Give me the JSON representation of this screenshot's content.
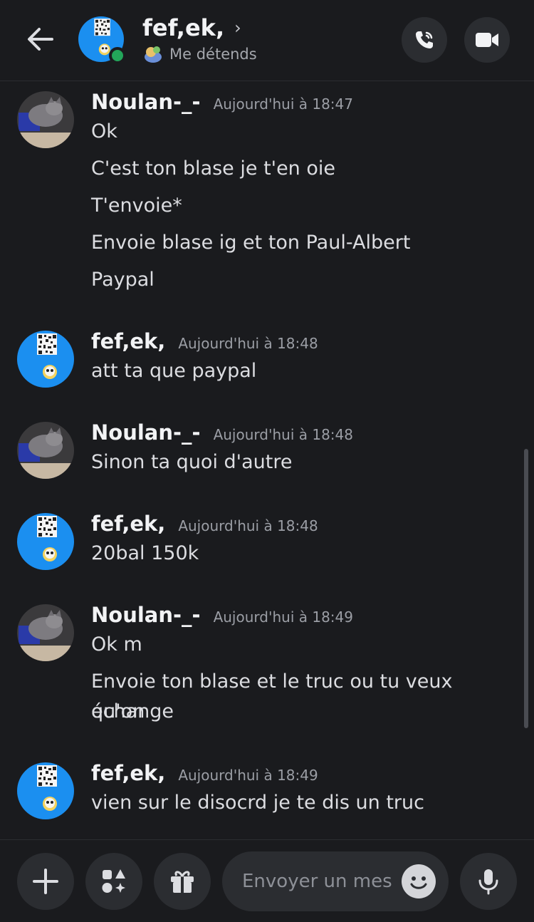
{
  "header": {
    "name": "fef,ek,",
    "status_text": "Me détends"
  },
  "messages": [
    {
      "author": "Noulan-_-",
      "time": "Aujourd'hui à 18:47",
      "avatar": "cat",
      "lines": [
        "Ok",
        "C'est ton blase je t'en oie",
        "T'envoie*",
        "Envoie blase ig et ton Paul-Albert",
        "Paypal"
      ]
    },
    {
      "author": "fef,ek,",
      "time": "Aujourd'hui à 18:48",
      "avatar": "qr",
      "lines": [
        "att ta que paypal"
      ]
    },
    {
      "author": "Noulan-_-",
      "time": "Aujourd'hui à 18:48",
      "avatar": "cat",
      "lines": [
        "Sinon ta quoi d'autre"
      ]
    },
    {
      "author": "fef,ek,",
      "time": "Aujourd'hui à 18:48",
      "avatar": "qr",
      "lines": [
        "20bal 150k"
      ]
    },
    {
      "author": "Noulan-_-",
      "time": "Aujourd'hui à 18:49",
      "avatar": "cat",
      "lines": [
        "Ok m",
        "Envoie ton blase et le truc ou tu veux qu'on",
        "échange"
      ]
    },
    {
      "author": "fef,ek,",
      "time": "Aujourd'hui à 18:49",
      "avatar": "qr",
      "lines": [
        "vien sur le disocrd je te dis un truc"
      ]
    }
  ],
  "composer": {
    "placeholder": "Envoyer un mes"
  },
  "icons": {
    "back": "arrow-left-icon",
    "call": "phone-call-icon",
    "video": "video-camera-icon",
    "plus": "plus-icon",
    "apps": "apps-icon",
    "gift": "gift-icon",
    "emoji": "emoji-icon",
    "mic": "microphone-icon"
  },
  "colors": {
    "background": "#1a1b1e",
    "online": "#23a55a",
    "button_bg": "#2b2d31"
  }
}
